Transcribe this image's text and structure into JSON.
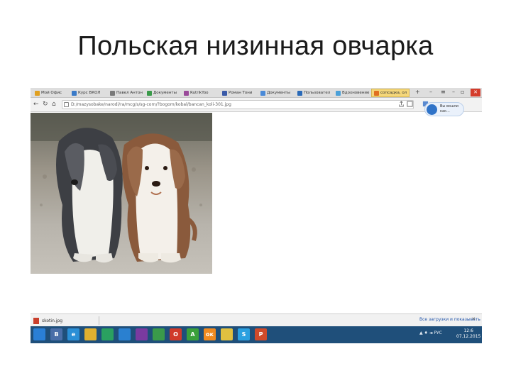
{
  "slide": {
    "title": "Польская низинная овчарка"
  },
  "browser": {
    "bookmarks": [
      {
        "label": "Мой Офис",
        "color": "#e0a020"
      },
      {
        "label": "Курс ВКОЛ",
        "color": "#3a7ac8"
      },
      {
        "label": "Павел Антон",
        "color": "#7a7a7a"
      },
      {
        "label": "Документы",
        "color": "#3a9a4a"
      },
      {
        "label": "RutrikYoo",
        "color": "#9a4a9a"
      },
      {
        "label": "Роман Тони",
        "color": "#3a5aa8"
      },
      {
        "label": "Документы",
        "color": "#4a8ad8"
      },
      {
        "label": "Пользовател",
        "color": "#2a6ab8"
      },
      {
        "label": "Вдохновение",
        "color": "#4aa0d8"
      },
      {
        "label": "сопсадка, ол",
        "color": "#e07020"
      }
    ],
    "url": "D:/mazysobake/narodi/ra/mcg/s/sg-corn/?bogom/kobal/bancan_koli-301.jpg",
    "badge_line1": "Вы вошли",
    "badge_line2": "как..."
  },
  "downloads": {
    "file_name": "skotin.jpg",
    "show_all": "Все загрузки и показывать",
    "close": "×"
  },
  "taskbar": {
    "apps": [
      {
        "name": "windows-start",
        "glyph": "",
        "color": "#2a7fd6"
      },
      {
        "name": "vk",
        "glyph": "B",
        "color": "#4a6ea8"
      },
      {
        "name": "internet-explorer",
        "glyph": "e",
        "color": "#2a8fd6"
      },
      {
        "name": "file-explorer",
        "glyph": "",
        "color": "#e0b030"
      },
      {
        "name": "store",
        "glyph": "",
        "color": "#2aa060"
      },
      {
        "name": "dropbox",
        "glyph": "",
        "color": "#2a80d0"
      },
      {
        "name": "media",
        "glyph": "",
        "color": "#7a3aa0"
      },
      {
        "name": "chrome",
        "glyph": "",
        "color": "#3a9a4a"
      },
      {
        "name": "opera",
        "glyph": "O",
        "color": "#d03a2a"
      },
      {
        "name": "antivirus",
        "glyph": "A",
        "color": "#3aa03a"
      },
      {
        "name": "odnoklassniki",
        "glyph": "ок",
        "color": "#f08a20"
      },
      {
        "name": "photos",
        "glyph": "",
        "color": "#e0c040"
      },
      {
        "name": "skype",
        "glyph": "S",
        "color": "#2aa0e0"
      },
      {
        "name": "powerpoint",
        "glyph": "P",
        "color": "#d04a2a"
      }
    ],
    "tray_text": "▲ ♦ ◄ РУС",
    "time": "12:6",
    "date": "07.12.2015"
  }
}
